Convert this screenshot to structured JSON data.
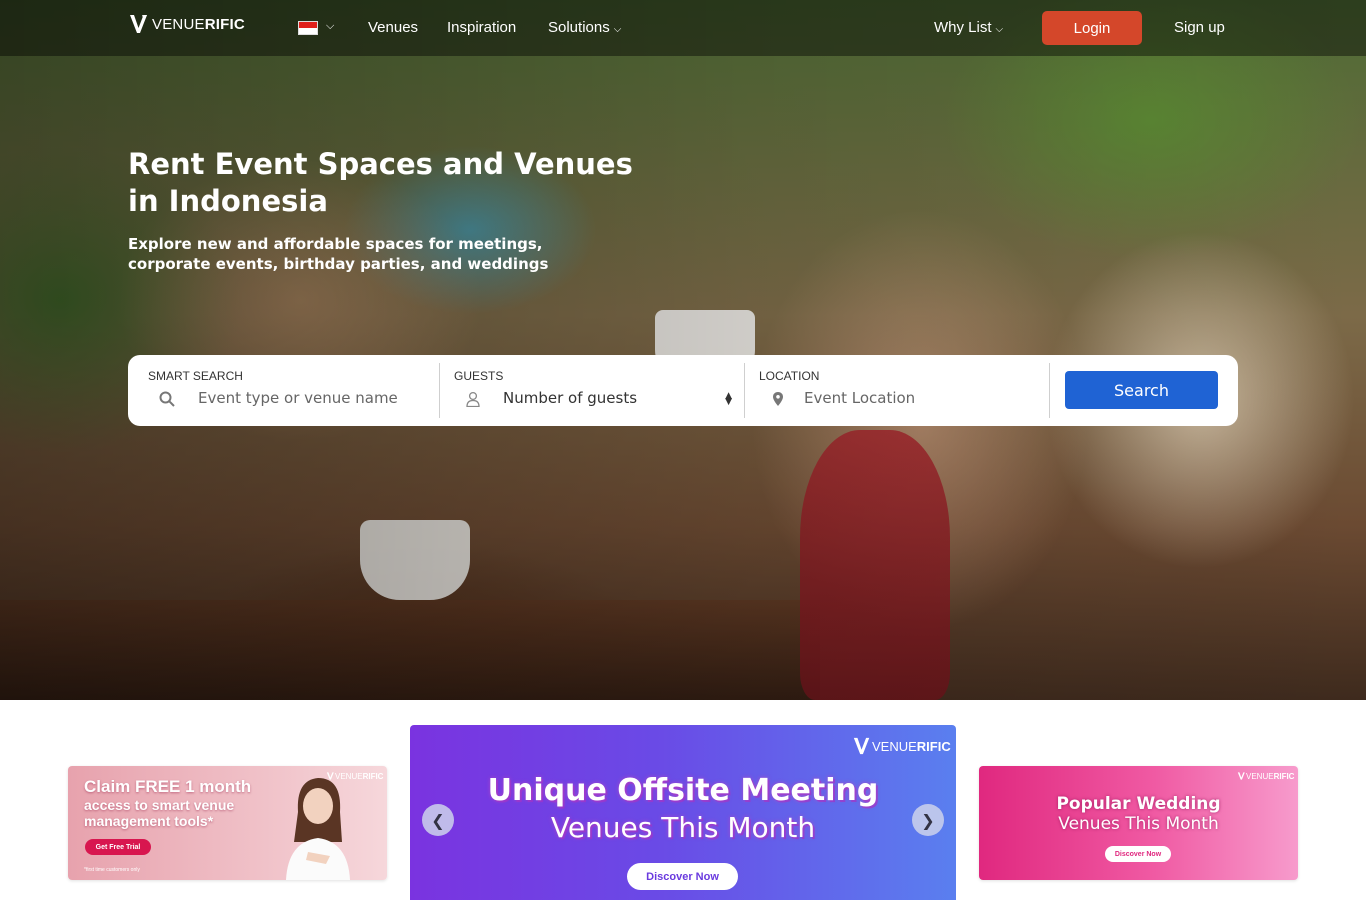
{
  "nav": {
    "logo_light": "VENUE",
    "logo_bold": "RIFIC",
    "country": "Indonesia",
    "links": [
      "Venues",
      "Inspiration",
      "Solutions",
      "Why List"
    ],
    "login_label": "Login",
    "signup_label": "Sign up"
  },
  "hero": {
    "title": "Rent Event Spaces and Venues in Indonesia",
    "subtitle": "Explore new and affordable spaces for meetings, corporate events, birthday parties, and weddings"
  },
  "search": {
    "smart_search_label": "SMART SEARCH",
    "smart_search_placeholder": "Event type or venue name",
    "guests_label": "GUESTS",
    "guests_selected": "Number of guests",
    "location_label": "LOCATION",
    "location_placeholder": "Event Location",
    "search_button": "Search"
  },
  "promos": {
    "left": {
      "title": "Claim FREE 1 month",
      "subtitle": "access to smart venue management tools*",
      "button": "Get Free Trial",
      "note": "*first time customers only"
    },
    "center": {
      "title": "Unique Offsite Meeting",
      "subtitle": "Venues This Month",
      "button": "Discover Now"
    },
    "right": {
      "title": "Popular Wedding",
      "subtitle": "Venues This Month",
      "button": "Discover Now"
    }
  },
  "colors": {
    "login": "#d4472a",
    "search_button": "#1f63d4",
    "promo_center": "#6a4ae6",
    "promo_right": "#e0287f"
  },
  "icons": [
    "search-icon",
    "user-icon",
    "map-pin-icon",
    "chevron-down-icon",
    "chevron-left-icon",
    "chevron-right-icon"
  ]
}
